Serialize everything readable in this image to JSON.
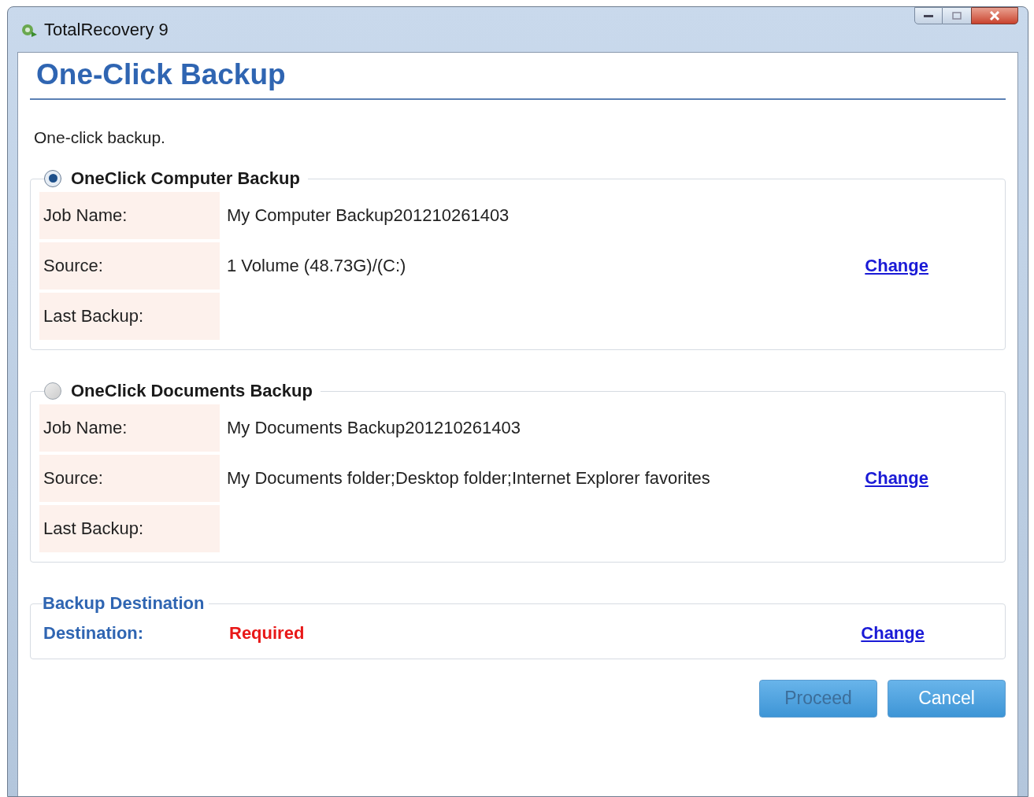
{
  "window": {
    "title": "TotalRecovery 9"
  },
  "heading": "One-Click Backup",
  "description": "One-click backup.",
  "backups": [
    {
      "title": "OneClick Computer Backup",
      "selected": true,
      "rows": [
        {
          "label": "Job Name:",
          "value": "My Computer Backup201210261403"
        },
        {
          "label": "Source:",
          "value": "1 Volume (48.73G)/(C:)",
          "link": "Change"
        },
        {
          "label": "Last Backup:"
        }
      ]
    },
    {
      "title": "OneClick Documents Backup",
      "selected": false,
      "rows": [
        {
          "label": "Job Name:",
          "value": "My Documents Backup201210261403"
        },
        {
          "label": "Source:",
          "value": "My Documents folder;Desktop folder;Internet Explorer favorites",
          "link": "Change"
        },
        {
          "label": "Last Backup:"
        }
      ]
    }
  ],
  "destination": {
    "title": "Backup Destination",
    "label": "Destination:",
    "value": "Required",
    "link": "Change"
  },
  "buttons": [
    {
      "label": "Proceed",
      "disabled": true
    },
    {
      "label": "Cancel",
      "disabled": false
    }
  ]
}
